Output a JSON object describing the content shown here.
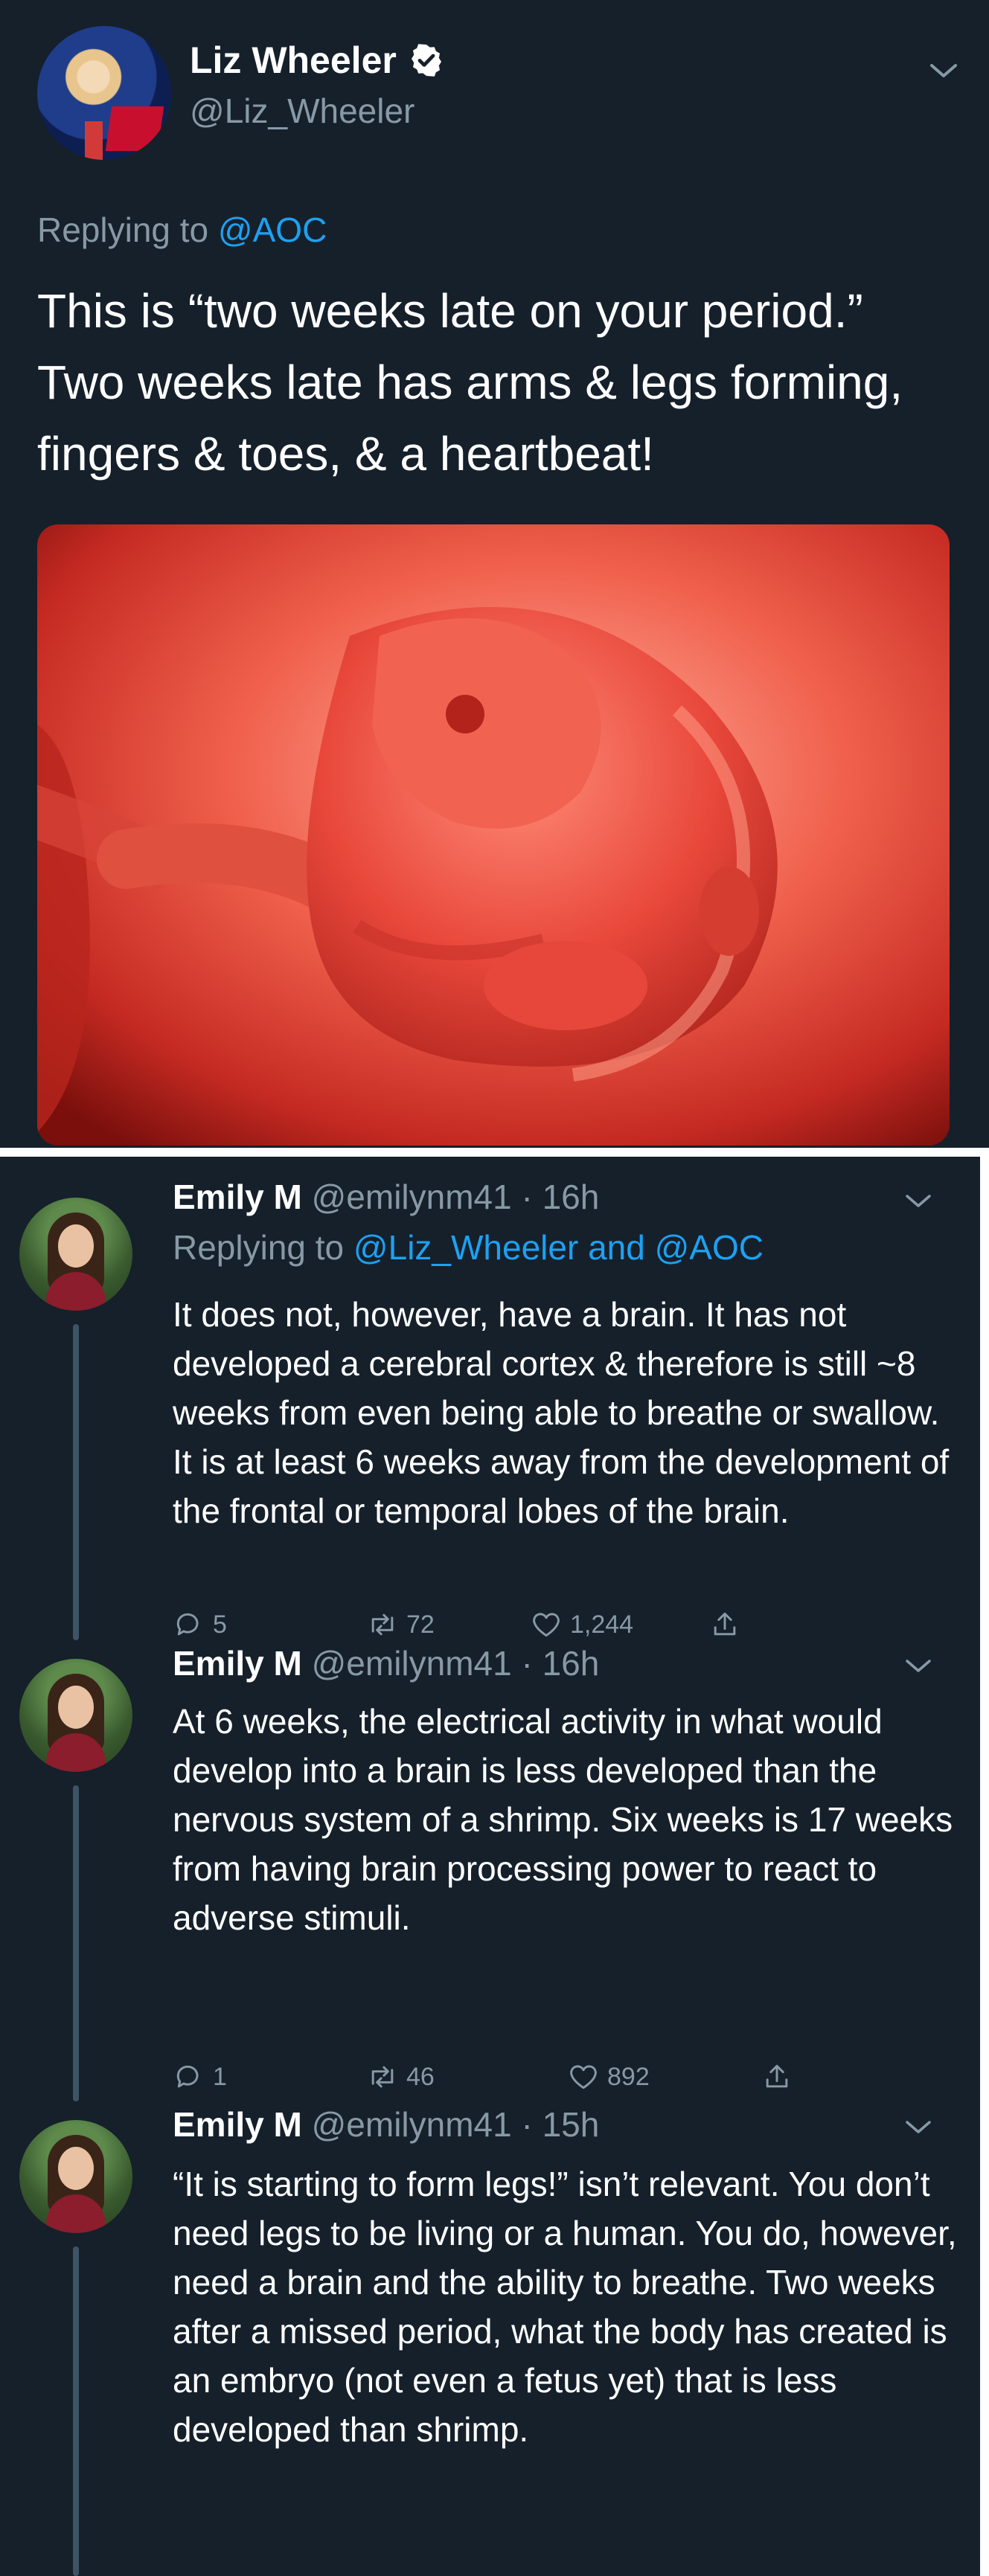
{
  "main_tweet": {
    "display_name": "Liz Wheeler",
    "handle": "@Liz_Wheeler",
    "replying_prefix": "Replying to",
    "replying_to": "@AOC",
    "text": "This is “two weeks late on your period.” Two weeks late has arms & legs forming, fingers & toes, & a heartbeat!",
    "media_alt": "embryo image"
  },
  "replies": [
    {
      "display_name": "Emily M",
      "handle": "@emilynm41",
      "time": "· 16h",
      "replying_prefix": "Replying to",
      "replying_to_1": "@Liz_Wheeler",
      "replying_join": "and",
      "replying_to_2": "@AOC",
      "text": "It does not, however, have a brain. It has not developed a cerebral cortex & therefore is still ~8 weeks from even being able to breathe or swallow. It is at least 6 weeks away from the development of the frontal or temporal lobes of the brain.",
      "replies": "5",
      "retweets": "72",
      "likes": "1,244"
    },
    {
      "display_name": "Emily M",
      "handle": "@emilynm41",
      "time": "· 16h",
      "text": "At 6 weeks, the electrical activity in what would develop into a brain is less developed than the nervous system of a shrimp. Six weeks is 17 weeks from having brain processing power to react to adverse stimuli.",
      "replies": "1",
      "retweets": "46",
      "likes": "892"
    },
    {
      "display_name": "Emily M",
      "handle": "@emilynm41",
      "time": "· 15h",
      "text": "“It is starting to form legs!” isn’t relevant. You don’t need legs to be living or a human. You do, however, need a brain and the ability to breathe. Two weeks after a missed period, what the body has created is an embryo (not even a fetus yet) that is less developed than shrimp."
    }
  ],
  "colors": {
    "background": "#15202b",
    "muted_text": "#8899a6",
    "link_blue": "#1da1f2",
    "thread_line": "#3d5466"
  },
  "icons": [
    "verified-badge-icon",
    "chevron-down-icon",
    "reply-icon",
    "retweet-icon",
    "like-icon",
    "share-icon"
  ]
}
